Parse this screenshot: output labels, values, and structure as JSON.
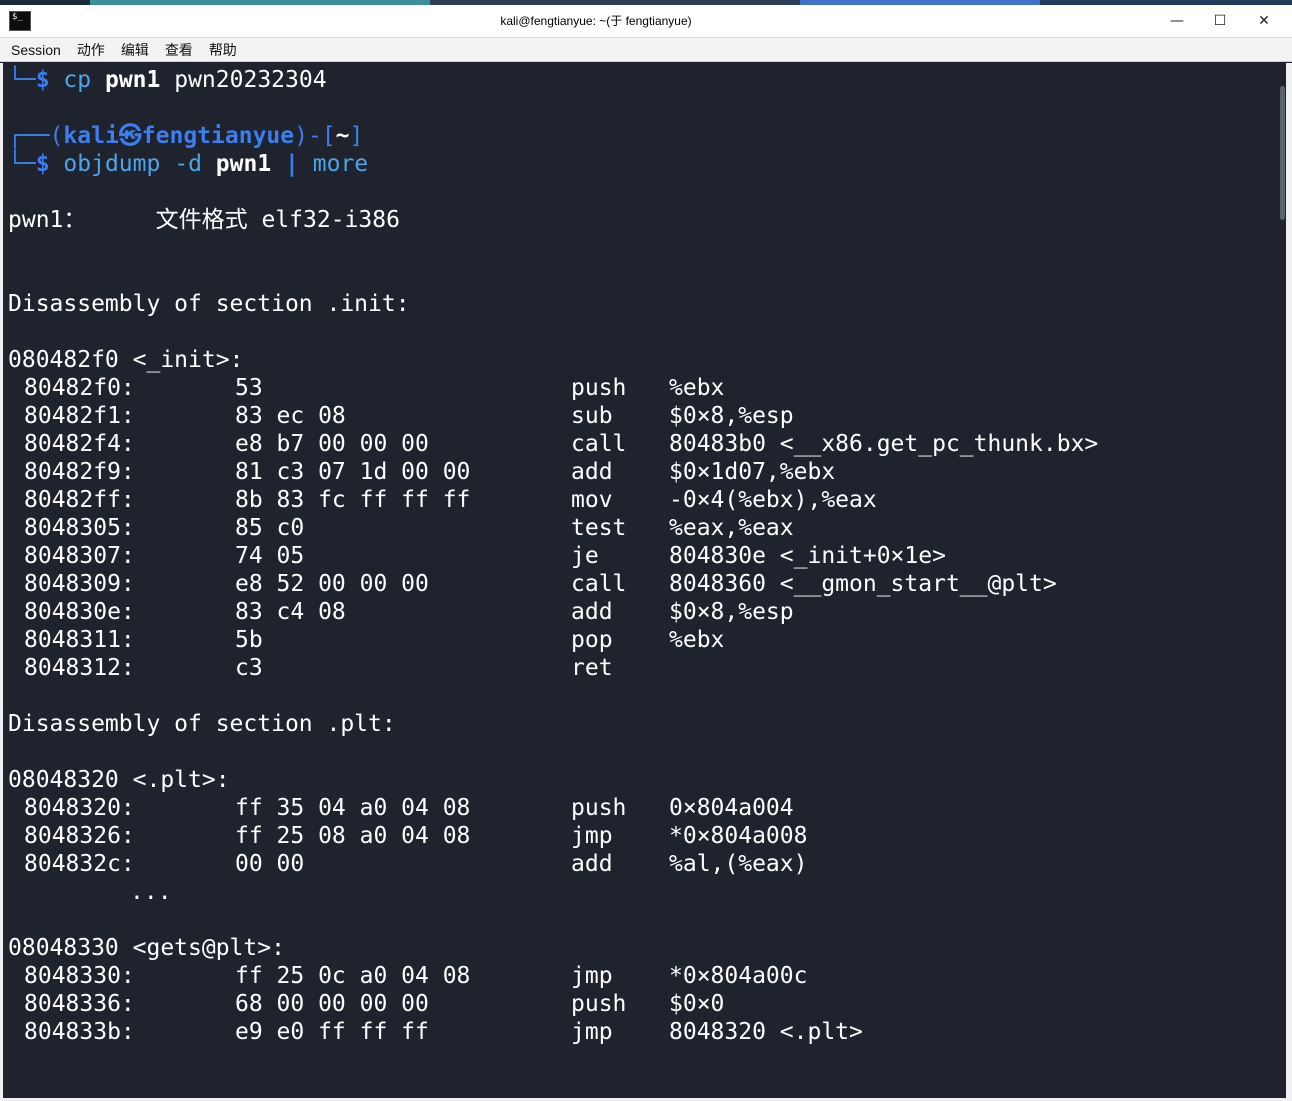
{
  "window": {
    "title": "kali@fengtianyue: ~(于 fengtianyue)",
    "minimize": "—",
    "maximize": "☐",
    "close": "✕"
  },
  "menu": [
    "Session",
    "动作",
    "编辑",
    "查看",
    "帮助"
  ],
  "terminal": {
    "prev_prompt_corner": "└─",
    "dollar": "$",
    "cp_cmd": "cp",
    "cp_arg1": "pwn1",
    "cp_arg2": "pwn20232304",
    "prompt_top_corner": "┌──",
    "prompt_open": "(",
    "user": "kali",
    "at_symbol": "㉿",
    "host": "fengtianyue",
    "prompt_close": ")-[",
    "cwd": "~",
    "prompt_end": "]",
    "prompt_bottom_corner": "└─",
    "objdump_cmd": "objdump",
    "objdump_flag": "-d",
    "objdump_arg": "pwn1",
    "pipe": "|",
    "more_cmd": "more",
    "file_format_line": "pwn1：     文件格式 elf32-i386",
    "section_init_header": "Disassembly of section .init:",
    "init_label": "080482f0 <_init>:",
    "section_plt_header": "Disassembly of section .plt:",
    "plt_label": "08048320 <.plt>:",
    "ellipsis": "...",
    "gets_label": "08048330 <gets@plt>:"
  },
  "init_rows": [
    {
      "addr": "80482f0:",
      "bytes": "53",
      "mnemonic": "push",
      "operands": "%ebx"
    },
    {
      "addr": "80482f1:",
      "bytes": "83 ec 08",
      "mnemonic": "sub",
      "operands": "$0×8,%esp"
    },
    {
      "addr": "80482f4:",
      "bytes": "e8 b7 00 00 00",
      "mnemonic": "call",
      "operands": "80483b0 <__x86.get_pc_thunk.bx>"
    },
    {
      "addr": "80482f9:",
      "bytes": "81 c3 07 1d 00 00",
      "mnemonic": "add",
      "operands": "$0×1d07,%ebx"
    },
    {
      "addr": "80482ff:",
      "bytes": "8b 83 fc ff ff ff",
      "mnemonic": "mov",
      "operands": "-0×4(%ebx),%eax"
    },
    {
      "addr": "8048305:",
      "bytes": "85 c0",
      "mnemonic": "test",
      "operands": "%eax,%eax"
    },
    {
      "addr": "8048307:",
      "bytes": "74 05",
      "mnemonic": "je",
      "operands": "804830e <_init+0×1e>"
    },
    {
      "addr": "8048309:",
      "bytes": "e8 52 00 00 00",
      "mnemonic": "call",
      "operands": "8048360 <__gmon_start__@plt>"
    },
    {
      "addr": "804830e:",
      "bytes": "83 c4 08",
      "mnemonic": "add",
      "operands": "$0×8,%esp"
    },
    {
      "addr": "8048311:",
      "bytes": "5b",
      "mnemonic": "pop",
      "operands": "%ebx"
    },
    {
      "addr": "8048312:",
      "bytes": "c3",
      "mnemonic": "ret",
      "operands": ""
    }
  ],
  "plt_rows": [
    {
      "addr": "8048320:",
      "bytes": "ff 35 04 a0 04 08",
      "mnemonic": "push",
      "operands": "0×804a004"
    },
    {
      "addr": "8048326:",
      "bytes": "ff 25 08 a0 04 08",
      "mnemonic": "jmp",
      "operands": "*0×804a008"
    },
    {
      "addr": "804832c:",
      "bytes": "00 00",
      "mnemonic": "add",
      "operands": "%al,(%eax)"
    }
  ],
  "gets_rows": [
    {
      "addr": "8048330:",
      "bytes": "ff 25 0c a0 04 08",
      "mnemonic": "jmp",
      "operands": "*0×804a00c"
    },
    {
      "addr": "8048336:",
      "bytes": "68 00 00 00 00",
      "mnemonic": "push",
      "operands": "$0×0"
    },
    {
      "addr": "804833b:",
      "bytes": "e9 e0 ff ff ff",
      "mnemonic": "jmp",
      "operands": "8048320 <.plt>"
    }
  ],
  "colors": {
    "terminal_bg": "#1f232e",
    "prompt_blue": "#3c7ef0",
    "command_cyan": "#4ca5e8"
  }
}
